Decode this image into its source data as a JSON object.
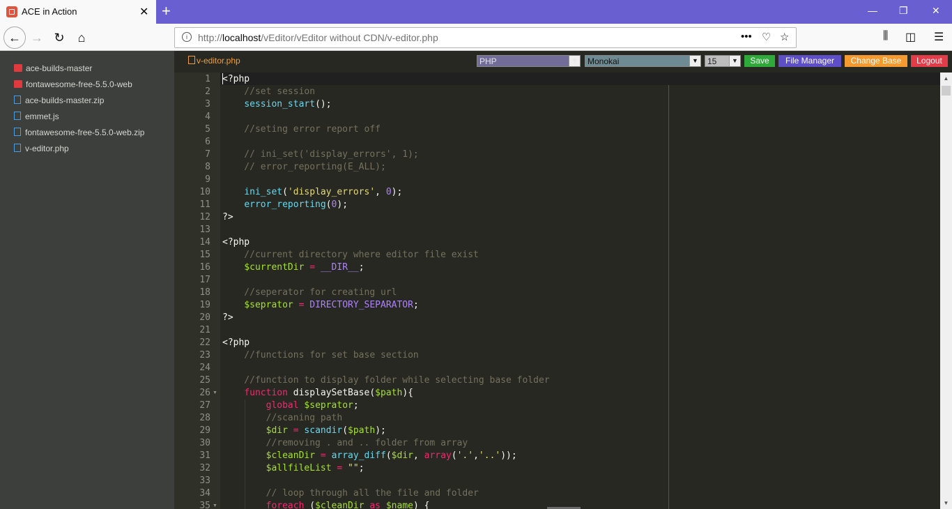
{
  "browser": {
    "tab_title": "ACE in Action",
    "tab_close": "✕",
    "new_tab": "+",
    "url_prefix": "http://",
    "url_host": "localhost",
    "url_path": "/vEditor/vEditor without CDN/v-editor.php",
    "window_controls": [
      "—",
      "❐",
      "✕"
    ],
    "icons": [
      "back-arrow-icon",
      "forward-arrow-icon",
      "reload-icon",
      "home-icon",
      "page-actions-icon",
      "pocket-icon",
      "bookmark-star-icon",
      "library-icon",
      "sidebar-icon",
      "menu-icon"
    ]
  },
  "sidebar": {
    "items": [
      {
        "label": "ace-builds-master",
        "type": "folder"
      },
      {
        "label": "fontawesome-free-5.5.0-web",
        "type": "folder"
      },
      {
        "label": "ace-builds-master.zip",
        "type": "file"
      },
      {
        "label": "emmet.js",
        "type": "file"
      },
      {
        "label": "fontawesome-free-5.5.0-web.zip",
        "type": "file"
      },
      {
        "label": "v-editor.php",
        "type": "file"
      }
    ]
  },
  "toolbar": {
    "current_file": "v-editor.php",
    "mode_select": "PHP",
    "theme_select": "Monokai",
    "fontsize_select": "15",
    "save_label": "Save",
    "file_manager_label": "File Manager",
    "change_base_label": "Change Base",
    "logout_label": "Logout",
    "colors": {
      "save": "#2ea93a",
      "file_manager": "#5f4fc6",
      "change_base": "#f49a2f",
      "logout": "#e23c48",
      "mode_select_bg": "#726c99",
      "theme_select_bg": "#6e8a92"
    }
  },
  "editor": {
    "theme_colors": {
      "bg": "#272822",
      "gutter": "#2f3129",
      "text": "#f8f8f2",
      "comment": "#75715e",
      "keyword": "#f92672",
      "function": "#66d9ef",
      "variable": "#a6e22e",
      "string": "#e6db74",
      "constant": "#ae81ff"
    },
    "lines": [
      {
        "n": "1",
        "code": "<?php"
      },
      {
        "n": "2",
        "code": "    //set session"
      },
      {
        "n": "3",
        "code": "    session_start();"
      },
      {
        "n": "4",
        "code": ""
      },
      {
        "n": "5",
        "code": "    //seting error report off"
      },
      {
        "n": "6",
        "code": ""
      },
      {
        "n": "7",
        "code": "    // ini_set('display_errors', 1);"
      },
      {
        "n": "8",
        "code": "    // error_reporting(E_ALL);"
      },
      {
        "n": "9",
        "code": ""
      },
      {
        "n": "10",
        "code": "    ini_set('display_errors', 0);"
      },
      {
        "n": "11",
        "code": "    error_reporting(0);"
      },
      {
        "n": "12",
        "code": "?>"
      },
      {
        "n": "13",
        "code": ""
      },
      {
        "n": "14",
        "code": "<?php"
      },
      {
        "n": "15",
        "code": "    //current directory where editor file exist"
      },
      {
        "n": "16",
        "code": "    $currentDir = __DIR__;"
      },
      {
        "n": "17",
        "code": ""
      },
      {
        "n": "18",
        "code": "    //seperator for creating url"
      },
      {
        "n": "19",
        "code": "    $seprator = DIRECTORY_SEPARATOR;"
      },
      {
        "n": "20",
        "code": "?>"
      },
      {
        "n": "21",
        "code": ""
      },
      {
        "n": "22",
        "code": "<?php"
      },
      {
        "n": "23",
        "code": "    //functions for set base section"
      },
      {
        "n": "24",
        "code": ""
      },
      {
        "n": "25",
        "code": "    //function to display folder while selecting base folder"
      },
      {
        "n": "26",
        "code": "    function displaySetBase($path){"
      },
      {
        "n": "27",
        "code": "        global $seprator;"
      },
      {
        "n": "28",
        "code": "        //scaning path"
      },
      {
        "n": "29",
        "code": "        $dir = scandir($path);"
      },
      {
        "n": "30",
        "code": "        //removing . and .. folder from array"
      },
      {
        "n": "31",
        "code": "        $cleanDir = array_diff($dir, array('.','..'));"
      },
      {
        "n": "32",
        "code": "        $allfileList = \"\";"
      },
      {
        "n": "33",
        "code": ""
      },
      {
        "n": "34",
        "code": "        // loop through all the file and folder"
      },
      {
        "n": "35",
        "code": "        foreach ($cleanDir as $name) {"
      }
    ]
  }
}
